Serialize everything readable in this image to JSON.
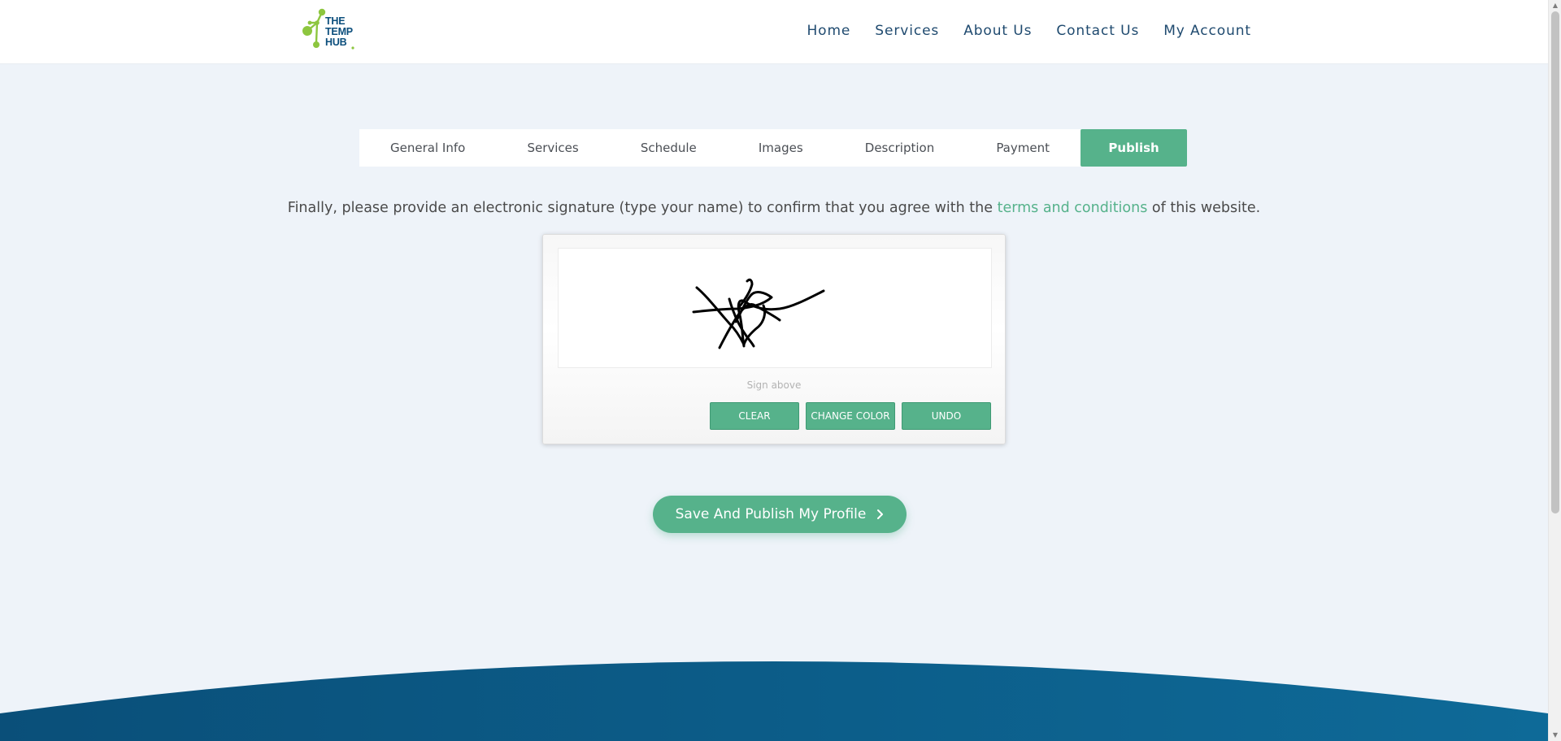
{
  "header": {
    "logo": {
      "line1": "THE",
      "line2": "TEMP",
      "line3": "HUB",
      "alt": "The Temp Hub logo"
    },
    "nav": [
      "Home",
      "Services",
      "About Us",
      "Contact Us",
      "My Account"
    ]
  },
  "tabs": [
    {
      "label": "General Info",
      "active": false
    },
    {
      "label": "Services",
      "active": false
    },
    {
      "label": "Schedule",
      "active": false
    },
    {
      "label": "Images",
      "active": false
    },
    {
      "label": "Description",
      "active": false
    },
    {
      "label": "Payment",
      "active": false
    },
    {
      "label": "Publish",
      "active": true
    }
  ],
  "instruction": {
    "before": "Finally, please provide an electronic signature (type your name) to confirm that you agree with the ",
    "link": "terms and conditions",
    "after": " of this website."
  },
  "signature": {
    "hint": "Sign above",
    "buttons": {
      "clear": "CLEAR",
      "change_color": "CHANGE COLOR",
      "undo": "UNDO"
    },
    "ink_color": "#000000"
  },
  "save_button": {
    "label": "Save And Publish My Profile",
    "icon": "chevron-right-icon"
  },
  "colors": {
    "accent": "#56b28b",
    "nav_text": "#1f4a6f",
    "page_background": "#eef3f9",
    "footer": "#0b5a86"
  }
}
